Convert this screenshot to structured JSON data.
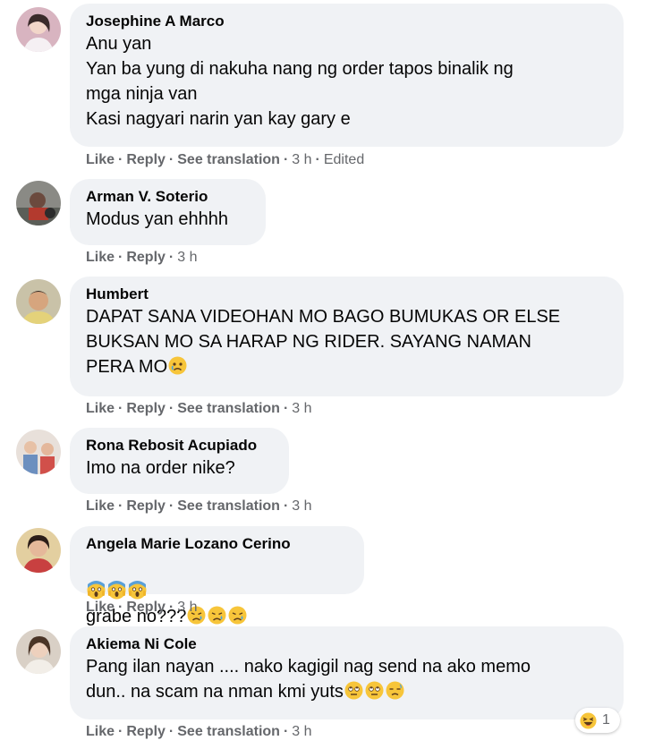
{
  "actions": {
    "like": "Like",
    "reply": "Reply",
    "see_translation": "See translation",
    "separator": "·"
  },
  "comments": [
    {
      "author": "Josephine A Marco",
      "text": "Anu yan\nYan ba yung di nakuha nang ng order tapos binalik ng\nmga ninja van\nKasi nagyari narin yan kay gary e",
      "time": "3 h",
      "edited": "Edited"
    },
    {
      "author": "Arman V. Soterio",
      "text": "Modus yan ehhhh",
      "time": "3 h"
    },
    {
      "author": "Humbert",
      "text": "DAPAT SANA VIDEOHAN MO BAGO BUMUKAS OR ELSE\nBUKSAN MO SA HARAP NG RIDER. SAYANG NAMAN\nPERA MO",
      "time": "3 h"
    },
    {
      "author": "Rona Rebosit Acupiado",
      "text": "Imo na order nike?",
      "time": "3 h"
    },
    {
      "author": "Angela Marie Lozano Cerino",
      "text": "grabe no???",
      "time": "3 h"
    },
    {
      "author": "Akiema Ni Cole",
      "text": "Pang ilan nayan .... nako kagigil nag send na ako memo\ndun.. na scam na nman kmi yuts",
      "time": "3 h",
      "reaction_count": "1"
    }
  ],
  "colors": {
    "bubble_bg": "#f0f2f5",
    "meta_text": "#65676b",
    "emoji_yellow": "#f7c53a"
  }
}
